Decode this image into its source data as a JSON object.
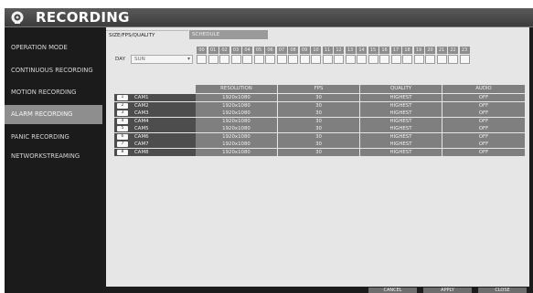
{
  "title": "RECORDING",
  "sidebar": {
    "items": [
      {
        "label": "OPERATION MODE"
      },
      {
        "label": "CONTINUOUS RECORDING"
      },
      {
        "label": "MOTION RECORDING"
      },
      {
        "label": "ALARM RECORDING"
      },
      {
        "label": "PANIC RECORDING"
      },
      {
        "label": "NETWORKSTREAMING"
      }
    ],
    "active_index": 3
  },
  "tabs": [
    {
      "label": "SIZE/FPS/QUALITY"
    },
    {
      "label": "SCHEDULE"
    }
  ],
  "schedule": {
    "day_label": "DAY",
    "day_value": "SUN",
    "hours": [
      "00",
      "01",
      "02",
      "03",
      "04",
      "05",
      "06",
      "07",
      "08",
      "09",
      "10",
      "11",
      "12",
      "13",
      "14",
      "15",
      "16",
      "17",
      "18",
      "19",
      "20",
      "21",
      "22",
      "23"
    ]
  },
  "table": {
    "headers": {
      "resolution": "RESOLUTION",
      "fps": "FPS",
      "quality": "QUALITY",
      "audio": "AUDIO"
    },
    "rows": [
      {
        "num": "1",
        "cam": "CAM1",
        "resolution": "1920x1080",
        "fps": "30",
        "quality": "HIGHEST",
        "audio": "OFF"
      },
      {
        "num": "2",
        "cam": "CAM2",
        "resolution": "1920x1080",
        "fps": "30",
        "quality": "HIGHEST",
        "audio": "OFF"
      },
      {
        "num": "3",
        "cam": "CAM3",
        "resolution": "1920x1080",
        "fps": "30",
        "quality": "HIGHEST",
        "audio": "OFF"
      },
      {
        "num": "4",
        "cam": "CAM4",
        "resolution": "1920x1080",
        "fps": "30",
        "quality": "HIGHEST",
        "audio": "OFF"
      },
      {
        "num": "5",
        "cam": "CAM5",
        "resolution": "1920x1080",
        "fps": "30",
        "quality": "HIGHEST",
        "audio": "OFF"
      },
      {
        "num": "6",
        "cam": "CAM6",
        "resolution": "1920x1080",
        "fps": "30",
        "quality": "HIGHEST",
        "audio": "OFF"
      },
      {
        "num": "7",
        "cam": "CAM7",
        "resolution": "1920x1080",
        "fps": "30",
        "quality": "HIGHEST",
        "audio": "OFF"
      },
      {
        "num": "8",
        "cam": "CAM8",
        "resolution": "1920x1080",
        "fps": "30",
        "quality": "HIGHEST",
        "audio": "OFF"
      }
    ]
  },
  "buttons": {
    "cancel": "CANCEL",
    "apply": "APPLY",
    "close": "CLOSE"
  }
}
